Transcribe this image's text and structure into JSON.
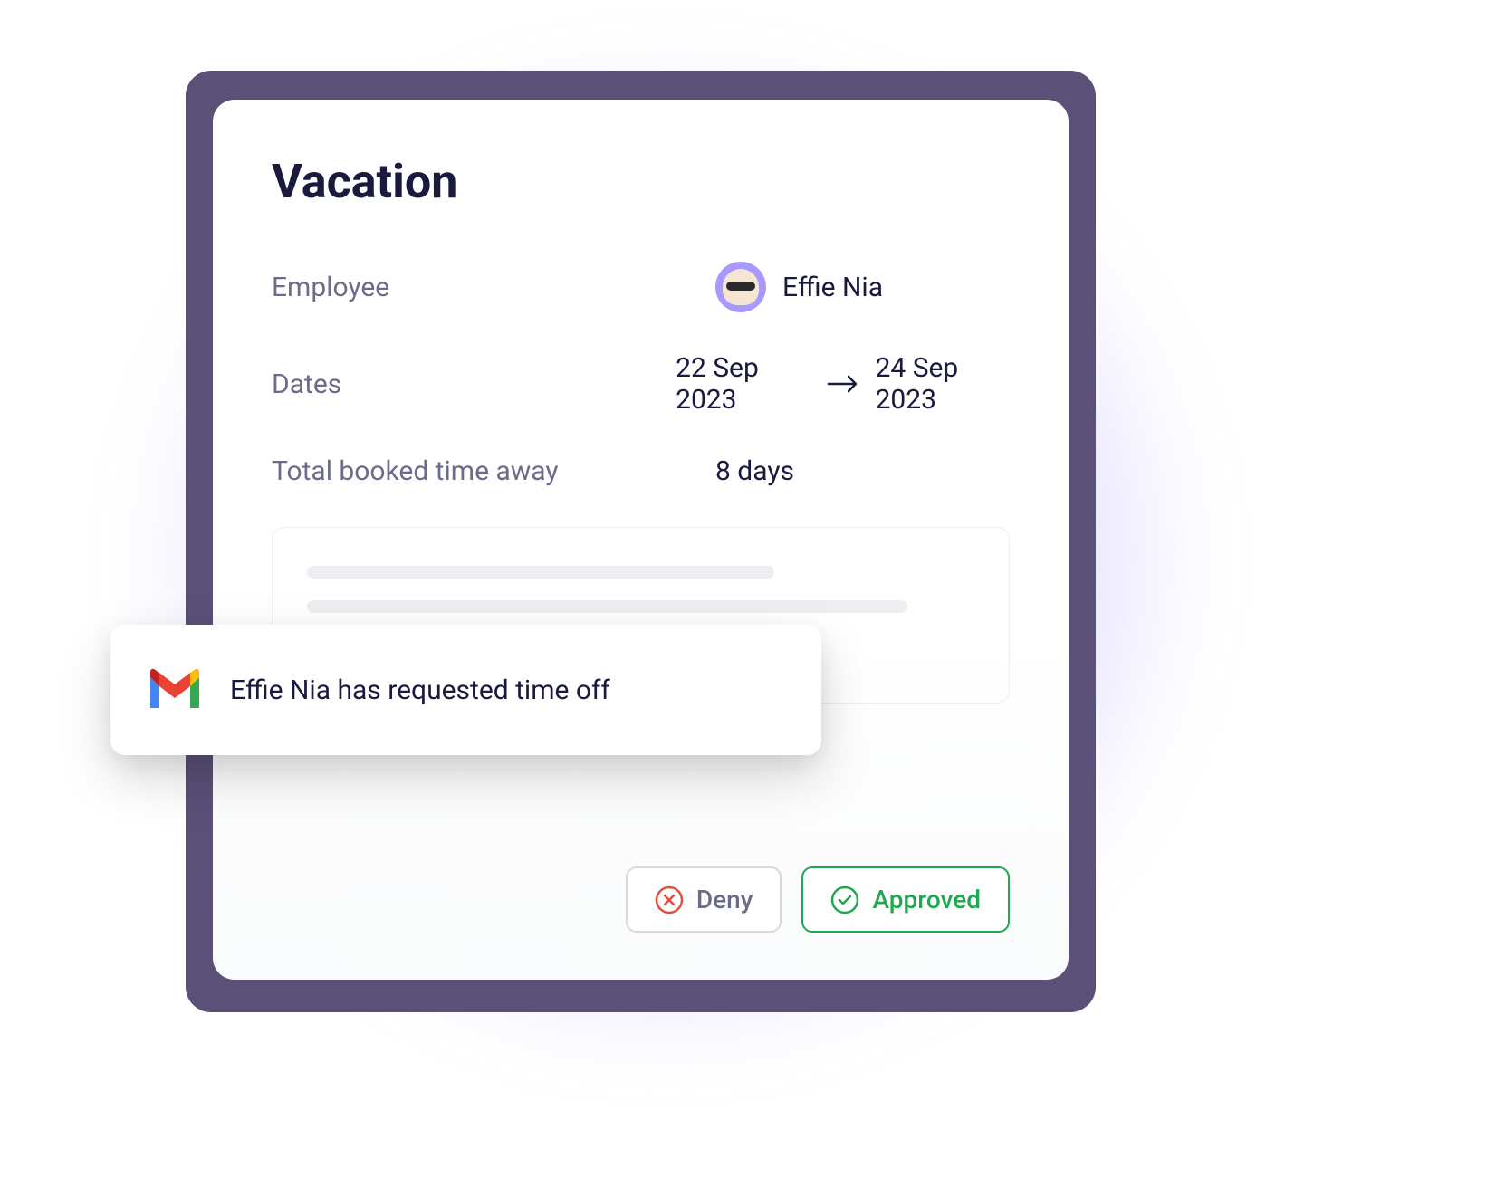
{
  "card": {
    "title": "Vacation",
    "employee_label": "Employee",
    "employee_name": "Effie Nia",
    "dates_label": "Dates",
    "date_start": "22 Sep 2023",
    "date_end": "24 Sep 2023",
    "total_label": "Total booked time away",
    "total_value": "8 days"
  },
  "actions": {
    "deny_label": "Deny",
    "approved_label": "Approved"
  },
  "notification": {
    "text": "Effie Nia  has requested time off"
  },
  "colors": {
    "accent": "#7c70ff",
    "success": "#1fa84f",
    "danger": "#e84c3d",
    "text_primary": "#1a1a3e",
    "text_muted": "#6b6b8a"
  }
}
